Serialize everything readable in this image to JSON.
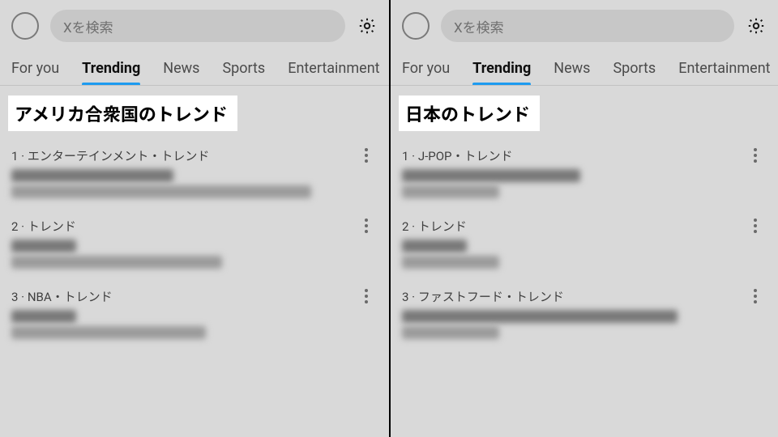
{
  "search": {
    "placeholder": "Xを検索"
  },
  "tabs": [
    {
      "label": "For you"
    },
    {
      "label": "Trending",
      "active": true
    },
    {
      "label": "News"
    },
    {
      "label": "Sports"
    },
    {
      "label": "Entertainment"
    }
  ],
  "left": {
    "heading": "アメリカ合衆国のトレンド",
    "items": [
      {
        "rank": "1",
        "category": "エンターテインメント・トレンド"
      },
      {
        "rank": "2",
        "category": "トレンド"
      },
      {
        "rank": "3",
        "category": "NBA・トレンド"
      }
    ]
  },
  "right": {
    "heading": "日本のトレンド",
    "items": [
      {
        "rank": "1",
        "category": "J-POP・トレンド"
      },
      {
        "rank": "2",
        "category": "トレンド"
      },
      {
        "rank": "3",
        "category": "ファストフード・トレンド"
      }
    ]
  },
  "sep": " · "
}
